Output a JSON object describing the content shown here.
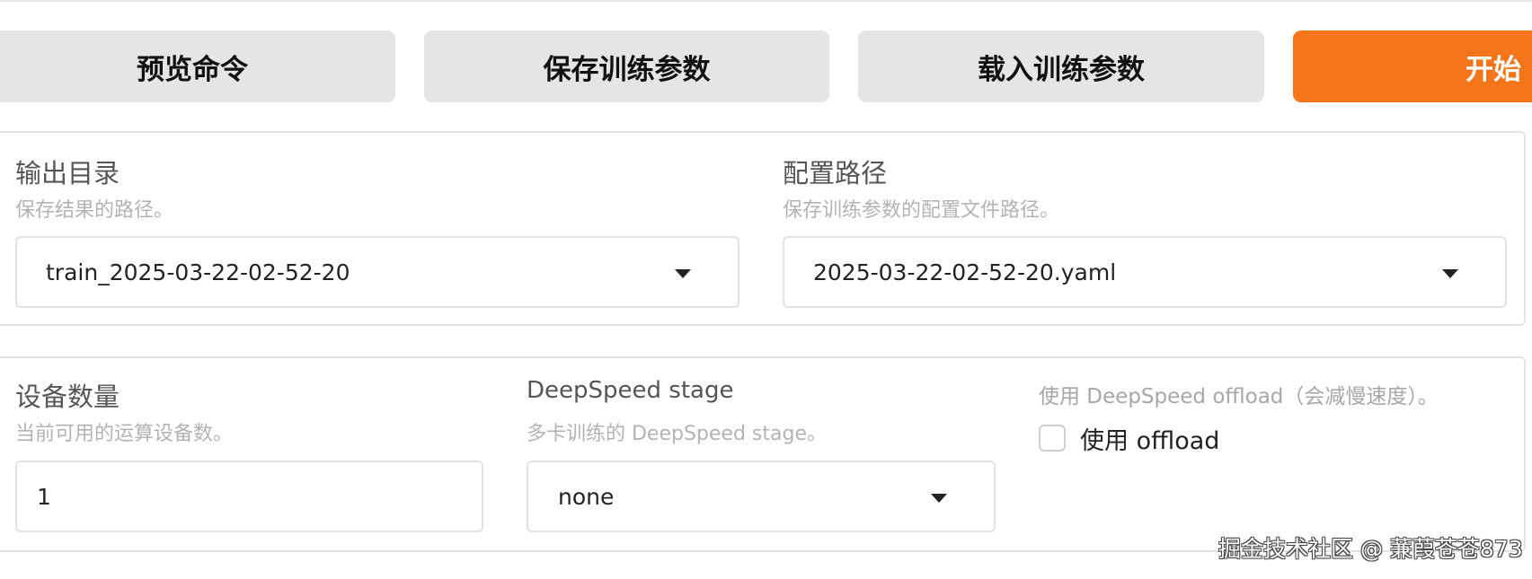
{
  "toolbar": {
    "preview_label": "预览命令",
    "save_label": "保存训练参数",
    "load_label": "载入训练参数",
    "start_label": "开始"
  },
  "colors": {
    "start_button": "#f5751b",
    "secondary_button": "#e5e5e8"
  },
  "output_dir": {
    "label": "输出目录",
    "info": "保存结果的路径。",
    "value": "train_2025-03-22-02-52-20"
  },
  "config_path": {
    "label": "配置路径",
    "info": "保存训练参数的配置文件路径。",
    "value": "2025-03-22-02-52-20.yaml"
  },
  "device_count": {
    "label": "设备数量",
    "info": "当前可用的运算设备数。",
    "value": "1"
  },
  "ds_stage": {
    "label": "DeepSpeed stage",
    "info": "多卡训练的 DeepSpeed stage。",
    "value": "none"
  },
  "ds_offload": {
    "label": "使用 DeepSpeed offload（会减慢速度）。",
    "checkbox_label": "使用 offload",
    "checked": false
  },
  "watermark": "掘金技术社区 @ 蒹葭苍苍873"
}
